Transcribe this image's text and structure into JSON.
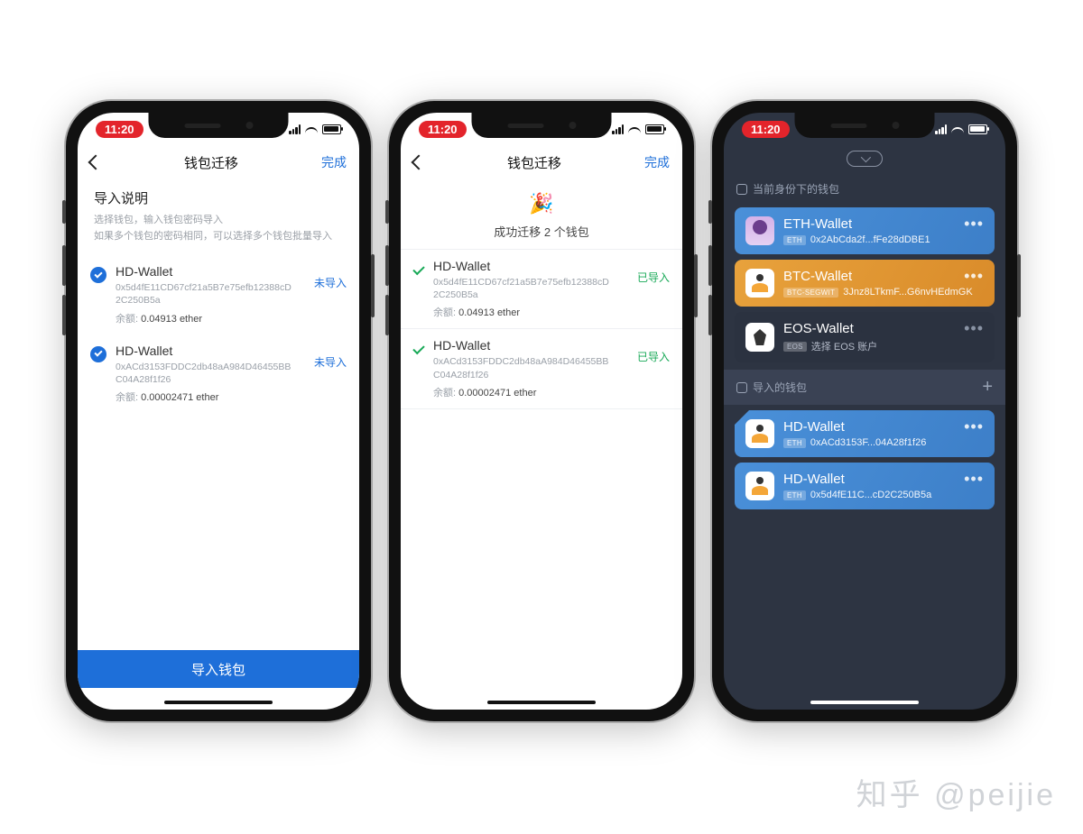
{
  "watermark": "知乎 @peijie",
  "status": {
    "time": "11:20"
  },
  "nav": {
    "title": "钱包迁移",
    "done": "完成"
  },
  "screen1": {
    "heading": "导入说明",
    "sub1": "选择钱包，输入钱包密码导入",
    "sub2": "如果多个钱包的密码相同，可以选择多个钱包批量导入",
    "wallets": [
      {
        "name": "HD-Wallet",
        "address": "0x5d4fE11CD67cf21a5B7e75efb12388cD2C250B5a",
        "balanceLabel": "余额:",
        "balance": "0.04913 ether",
        "status": "未导入"
      },
      {
        "name": "HD-Wallet",
        "address": "0xACd3153FDDC2db48aA984D46455BBC04A28f1f26",
        "balanceLabel": "余额:",
        "balance": "0.00002471 ether",
        "status": "未导入"
      }
    ],
    "importBtn": "导入钱包"
  },
  "screen2": {
    "successText": "成功迁移 2 个钱包",
    "wallets": [
      {
        "name": "HD-Wallet",
        "address": "0x5d4fE11CD67cf21a5B7e75efb12388cD2C250B5a",
        "balanceLabel": "余额:",
        "balance": "0.04913 ether",
        "status": "已导入"
      },
      {
        "name": "HD-Wallet",
        "address": "0xACd3153FDDC2db48aA984D46455BBC04A28f1f26",
        "balanceLabel": "余额:",
        "balance": "0.00002471 ether",
        "status": "已导入"
      }
    ]
  },
  "screen3": {
    "section1": "当前身份下的钱包",
    "section2": "导入的钱包",
    "idWallets": [
      {
        "name": "ETH-Wallet",
        "tag": "ETH",
        "addr": "0x2AbCda2f...fFe28dDBE1"
      },
      {
        "name": "BTC-Wallet",
        "tag": "BTC-SEGWIT",
        "addr": "3Jnz8LTkmF...G6nvHEdmGK"
      },
      {
        "name": "EOS-Wallet",
        "tag": "EOS",
        "addr": "选择 EOS 账户"
      }
    ],
    "impWallets": [
      {
        "name": "HD-Wallet",
        "tag": "ETH",
        "addr": "0xACd3153F...04A28f1f26"
      },
      {
        "name": "HD-Wallet",
        "tag": "ETH",
        "addr": "0x5d4fE11C...cD2C250B5a"
      }
    ]
  }
}
